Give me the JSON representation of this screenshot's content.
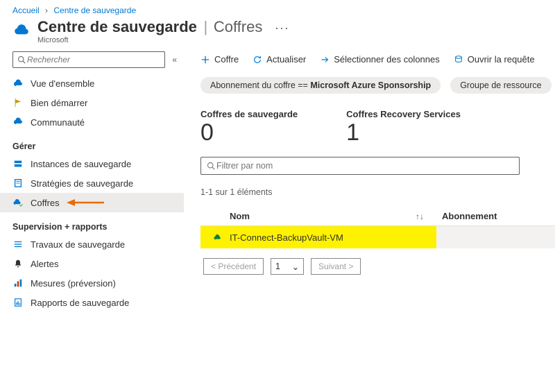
{
  "breadcrumb": {
    "home": "Accueil",
    "center": "Centre de sauvegarde"
  },
  "header": {
    "title": "Centre de sauvegarde",
    "subtitle": "Coffres",
    "provider": "Microsoft"
  },
  "search": {
    "placeholder": "Rechercher"
  },
  "nav": {
    "items": [
      {
        "label": "Vue d'ensemble"
      },
      {
        "label": "Bien démarrer"
      },
      {
        "label": "Communauté"
      }
    ],
    "group_manage": "Gérer",
    "manage_items": [
      {
        "label": "Instances de sauvegarde"
      },
      {
        "label": "Stratégies de sauvegarde"
      },
      {
        "label": "Coffres"
      }
    ],
    "group_reports": "Supervision + rapports",
    "report_items": [
      {
        "label": "Travaux de sauvegarde"
      },
      {
        "label": "Alertes"
      },
      {
        "label": "Mesures (préversion)"
      },
      {
        "label": "Rapports de sauvegarde"
      }
    ]
  },
  "cmdbar": {
    "create": "Coffre",
    "refresh": "Actualiser",
    "columns": "Sélectionner des colonnes",
    "query": "Ouvrir la requête"
  },
  "pills": {
    "sub_label": "Abonnement du coffre == ",
    "sub_value": "Microsoft Azure Sponsorship",
    "rg": "Groupe de ressource"
  },
  "stats": {
    "backup_label": "Coffres de sauvegarde",
    "backup_val": "0",
    "rs_label": "Coffres Recovery Services",
    "rs_val": "1"
  },
  "filter": {
    "placeholder": "Filtrer par nom"
  },
  "result_count": "1-1 sur 1 éléments",
  "table": {
    "col_name": "Nom",
    "col_sub": "Abonnement",
    "rows": [
      {
        "name": "IT-Connect-BackupVault-VM"
      }
    ]
  },
  "pager": {
    "prev": "< Précédent",
    "page": "1",
    "next": "Suivant >"
  }
}
